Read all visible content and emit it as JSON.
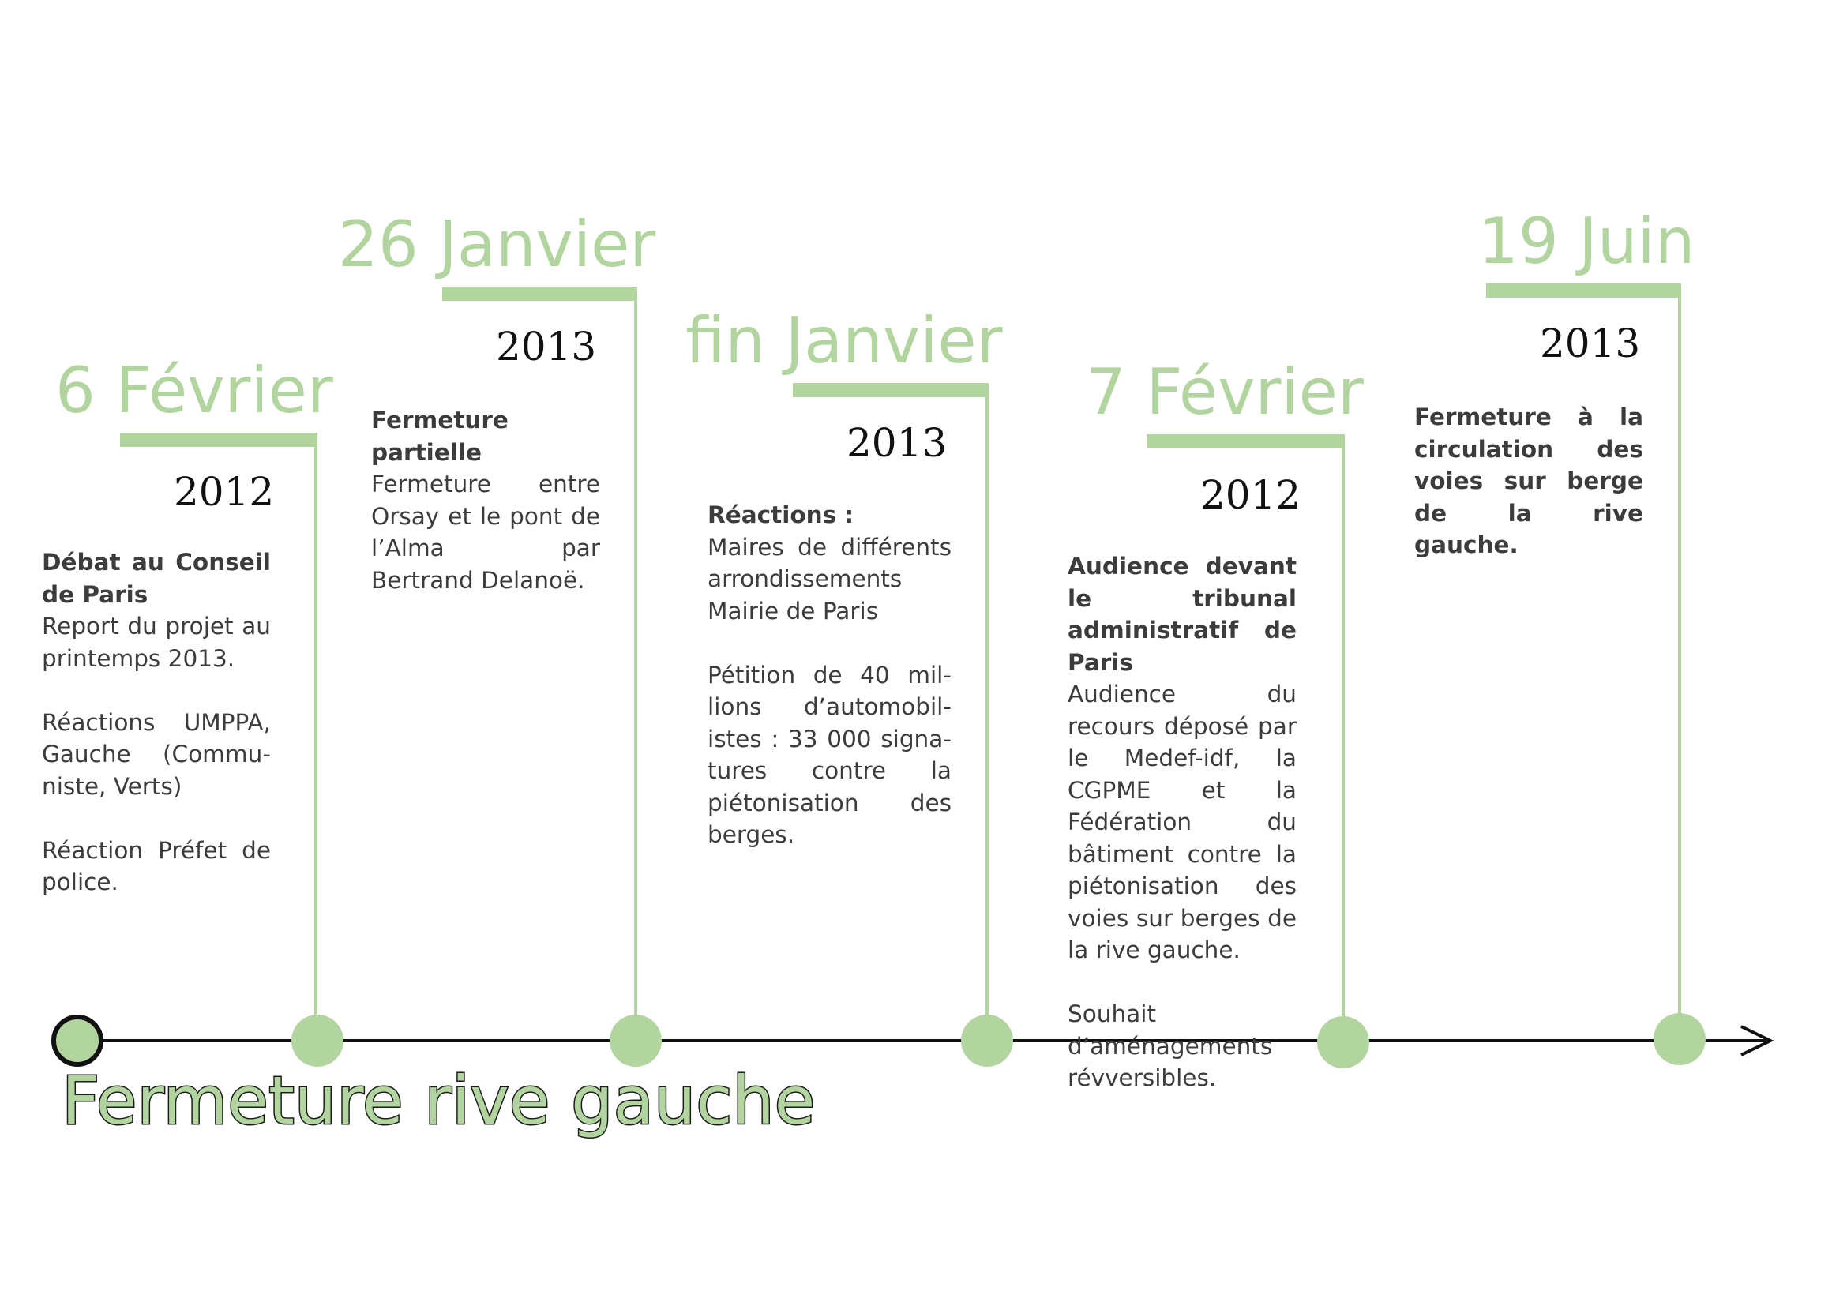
{
  "title": "Fermeture rive gauche",
  "colors": {
    "accent": "#b2d59f",
    "axis": "#111111",
    "text": "#3c3c3c"
  },
  "events": [
    {
      "date": "6 Février",
      "year": "2012",
      "paragraphs": [
        {
          "head": "Débat au Conseil de Paris",
          "text": "Report du projet au printemps 2013."
        },
        {
          "head": "",
          "text": "Réactions UMPPA, Gauche (Commu­niste, Verts)"
        },
        {
          "head": "",
          "text": "Réaction Préfet de police."
        }
      ]
    },
    {
      "date": "26 Janvier",
      "year": "2013",
      "paragraphs": [
        {
          "head": "Fermeture partielle",
          "text": "Fermeture entre Orsay et le pont de l’Alma par Bertrand Delanoë."
        }
      ]
    },
    {
      "date": "fin Janvier",
      "year": "2013",
      "paragraphs": [
        {
          "head": "Réactions :",
          "text": "Maires de différents arrondissements Mairie de Paris"
        },
        {
          "head": "",
          "text": "Pétition de 40 mil­lions d’automobil­istes : 33 000 signa­tures contre la piétonisation des berges."
        }
      ]
    },
    {
      "date": "7 Février",
      "year": "2012",
      "paragraphs": [
        {
          "head": "Audience devant le tribunal administra­tif de Paris",
          "text": "Audience du recours déposé par le Medef-idf, la CGPME et la Fédération du bâtiment contre la piétonisation des voies sur berges de la rive gauche."
        },
        {
          "head": "",
          "text": "Souhait d’aménage­ments révversibles."
        }
      ]
    },
    {
      "date": "19 Juin",
      "year": "2013",
      "paragraphs": [
        {
          "head": "Fermeture à la cir­culation des voies sur berge de la rive gauche.",
          "text": ""
        }
      ]
    }
  ]
}
